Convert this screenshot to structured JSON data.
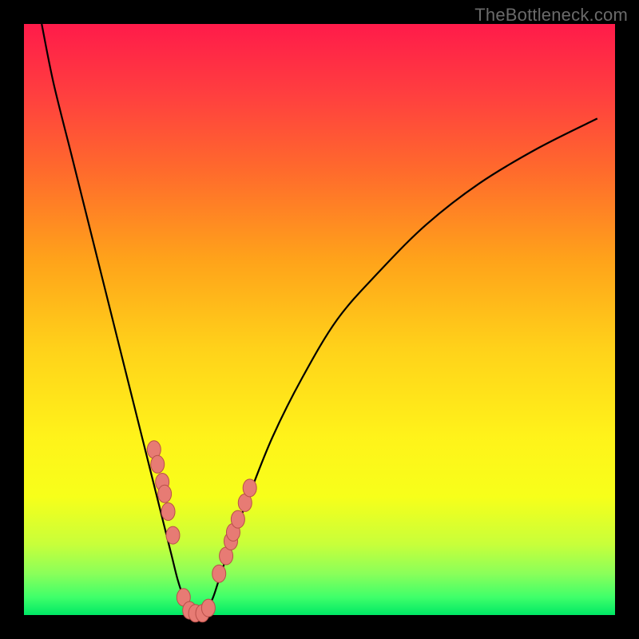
{
  "watermark": "TheBottleneck.com",
  "colors": {
    "frame": "#000000",
    "curve": "#000000",
    "marker_fill": "#e77b74",
    "marker_stroke": "#b94f49",
    "highlight_band": "#dfff4a"
  },
  "chart_data": {
    "type": "line",
    "title": "",
    "xlabel": "",
    "ylabel": "",
    "xlim": [
      0,
      100
    ],
    "ylim": [
      0,
      100
    ],
    "series": [
      {
        "name": "bottleneck-curve",
        "x": [
          3,
          5,
          8,
          10,
          12,
          14,
          16,
          18,
          20,
          22,
          24,
          25,
          26,
          27,
          28,
          29,
          30,
          31,
          32,
          33,
          35,
          38,
          42,
          47,
          53,
          60,
          68,
          77,
          87,
          97
        ],
        "y": [
          100,
          90,
          78,
          70,
          62,
          54,
          46,
          38,
          30,
          22,
          14,
          10,
          6,
          3,
          1,
          0,
          0,
          1,
          3,
          6,
          12,
          20,
          30,
          40,
          50,
          58,
          66,
          73,
          79,
          84
        ]
      }
    ],
    "markers": {
      "name": "highlighted-points",
      "x": [
        22.0,
        22.6,
        23.4,
        23.8,
        24.4,
        25.2,
        27.0,
        28.0,
        29.0,
        30.2,
        31.2,
        33.0,
        34.2,
        35.0,
        35.4,
        36.2,
        37.4,
        38.2
      ],
      "y": [
        28.0,
        25.5,
        22.5,
        20.5,
        17.5,
        13.5,
        3.0,
        0.8,
        0.3,
        0.3,
        1.2,
        7.0,
        10.0,
        12.5,
        14.0,
        16.2,
        19.0,
        21.5
      ]
    },
    "highlight_band_y": [
      74,
      82
    ]
  }
}
